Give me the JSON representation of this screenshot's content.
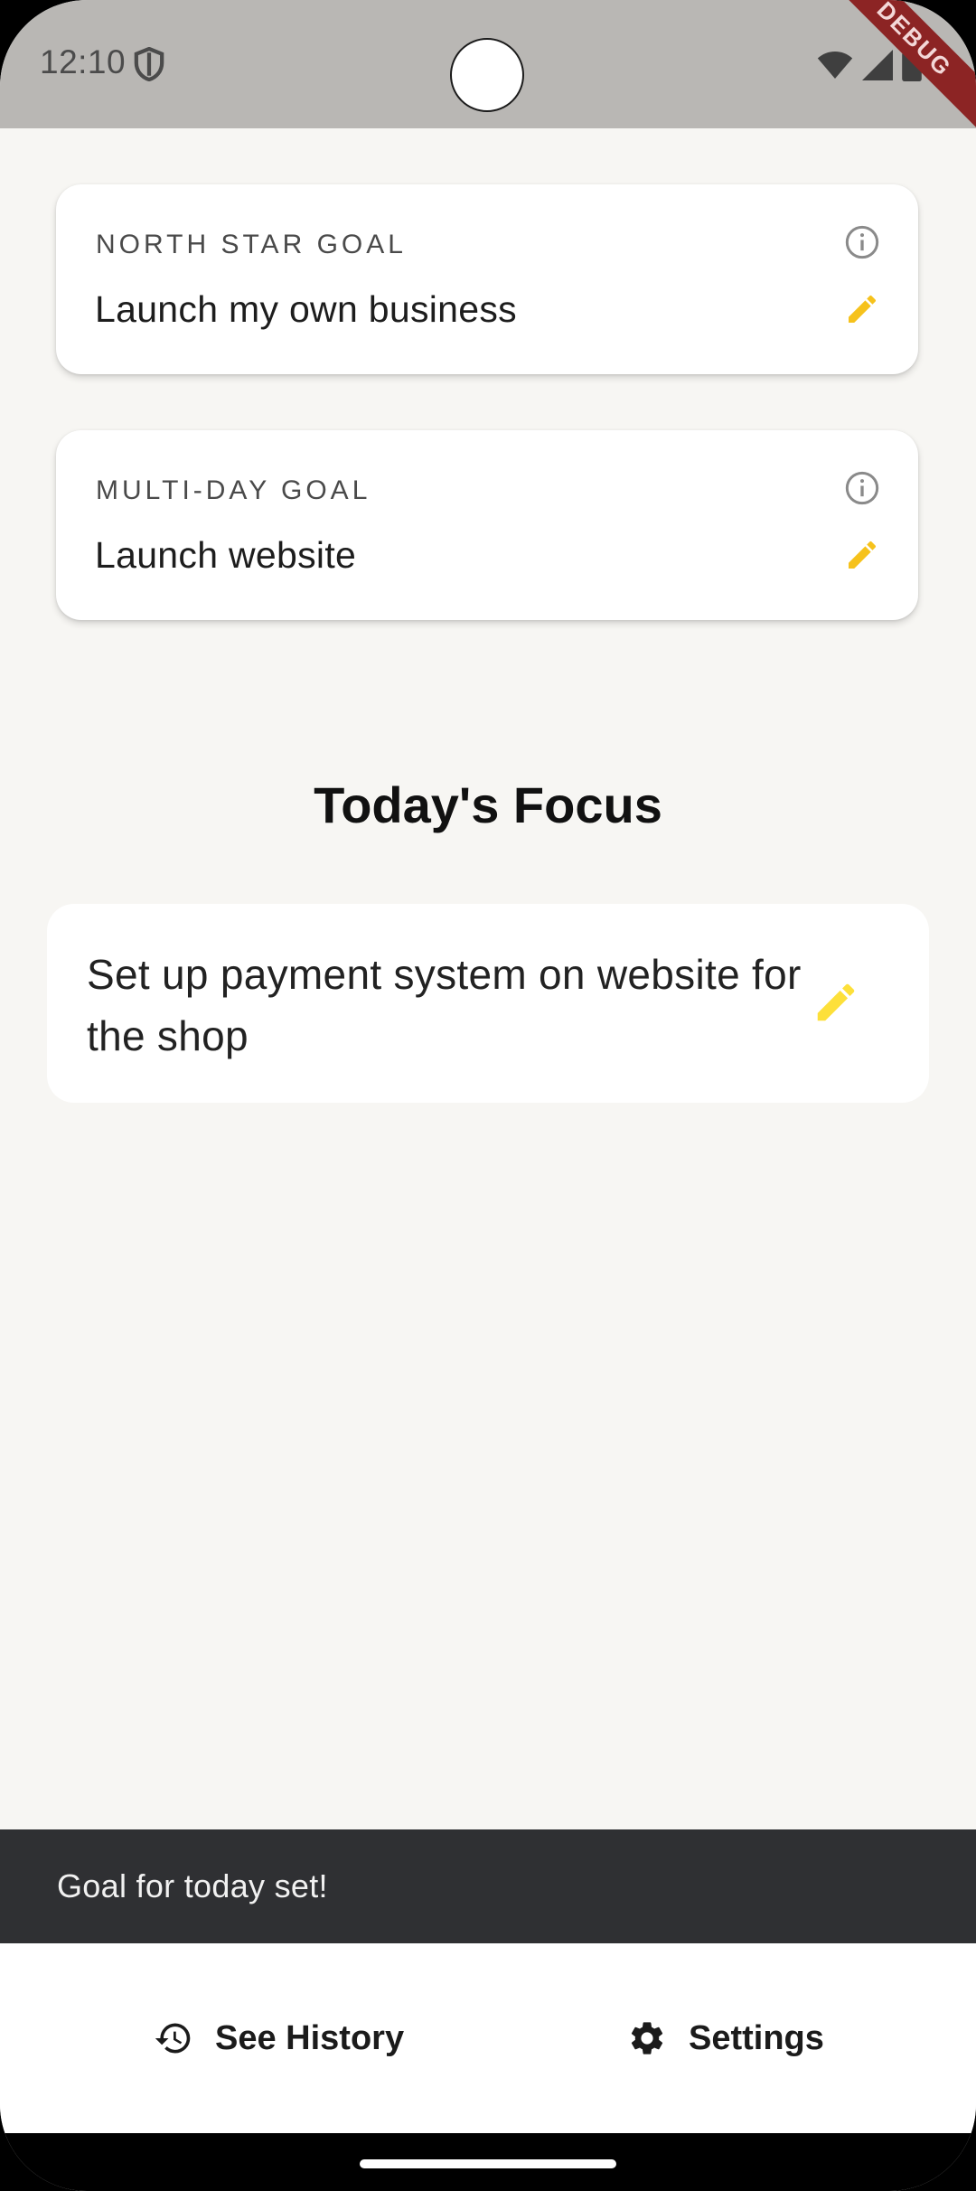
{
  "status_bar": {
    "time": "12:10",
    "debug_label": "DEBUG",
    "icons": [
      "shield-icon",
      "wifi-icon",
      "signal-icon",
      "battery-icon"
    ]
  },
  "north_star": {
    "label": "NORTH STAR GOAL",
    "text": "Launch my own business"
  },
  "multi_day": {
    "label": "MULTI-DAY GOAL",
    "text": "Launch website"
  },
  "focus": {
    "heading": "Today's Focus",
    "text": "Set up payment system on website for the shop"
  },
  "snackbar": {
    "message": "Goal for today set!"
  },
  "bottom_bar": {
    "history_label": "See History",
    "settings_label": "Settings"
  },
  "colors": {
    "background": "#f7f6f3",
    "status_bar": "#b9b7b4",
    "accent_edit_small": "#f6c21c",
    "accent_edit_large": "#fde03a",
    "snackbar": "#2f3033",
    "debug_ribbon": "#8c2424"
  }
}
